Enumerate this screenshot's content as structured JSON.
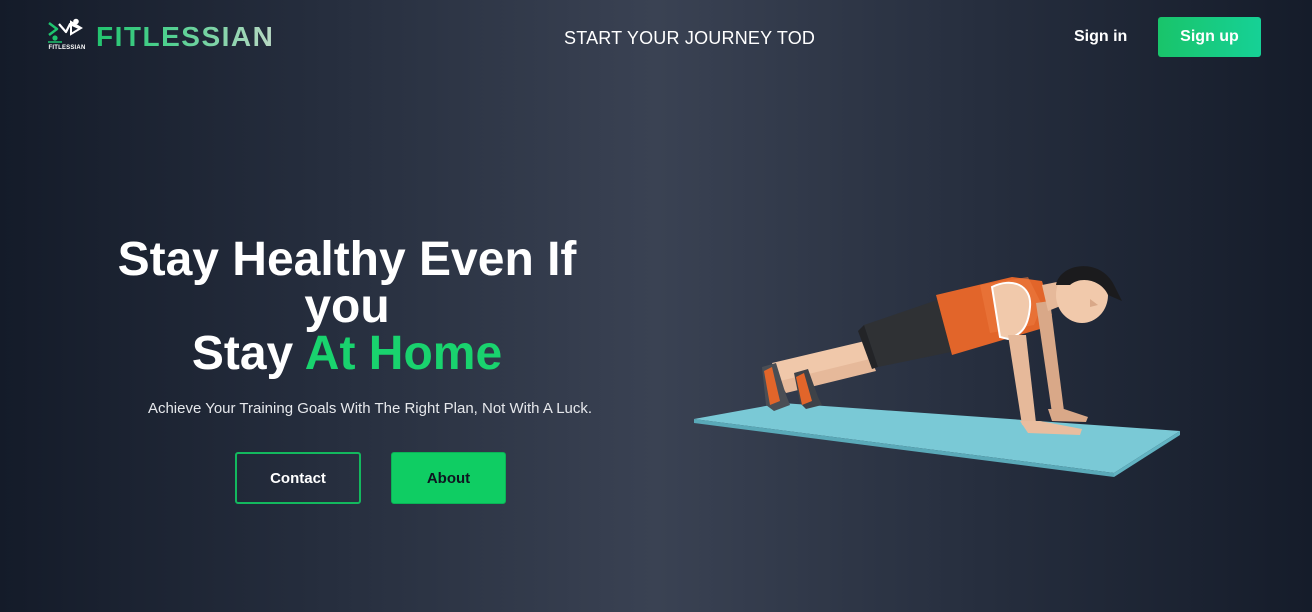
{
  "brand": {
    "name": "FITLESSIAN",
    "mark_caption": "FITLESSIAN"
  },
  "nav": {
    "tagline": "START YOUR JOURNEY TOD",
    "signin_label": "Sign in",
    "signup_label": "Sign up"
  },
  "hero": {
    "title_line1": "Stay Healthy Even If",
    "title_line2": "you",
    "title_line3_prefix": "Stay",
    "title_line3_accent": "At Home",
    "subtitle": "Achieve Your Training Goals With The Right Plan, Not With A Luck.",
    "contact_label": "Contact",
    "about_label": "About"
  },
  "illustration": {
    "icon": "pushup-man-illustration"
  },
  "colors": {
    "accent": "#19d36e",
    "button_green": "#0fcd63",
    "background_dark": "#141b29",
    "background_mid": "#3a4253",
    "mat": "#7ac9d6",
    "shirt": "#e2652a"
  }
}
